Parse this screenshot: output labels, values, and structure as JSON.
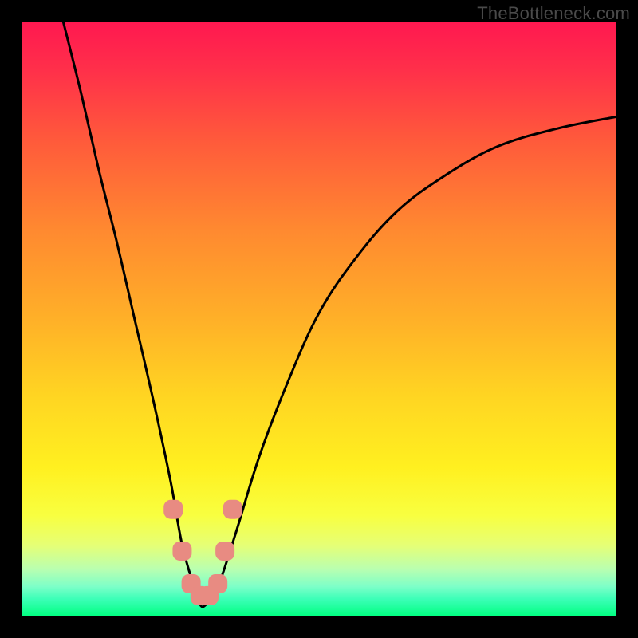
{
  "attribution": "TheBottleneck.com",
  "chart_data": {
    "type": "line",
    "title": "",
    "xlabel": "",
    "ylabel": "",
    "xlim": [
      0,
      100
    ],
    "ylim": [
      0,
      100
    ],
    "series": [
      {
        "name": "bottleneck-curve",
        "x": [
          7,
          10,
          13,
          16,
          19,
          22,
          25,
          27,
          29,
          30,
          31,
          33,
          36,
          40,
          45,
          50,
          56,
          63,
          71,
          80,
          90,
          100
        ],
        "y": [
          100,
          88,
          75,
          63,
          50,
          37,
          23,
          12,
          5,
          2,
          2,
          5,
          14,
          27,
          40,
          51,
          60,
          68,
          74,
          79,
          82,
          84
        ]
      }
    ],
    "markers": {
      "name": "highlight-dots",
      "color": "#e88b82",
      "points_xy": [
        [
          25.5,
          18
        ],
        [
          27,
          11
        ],
        [
          28.5,
          5.5
        ],
        [
          30,
          3.5
        ],
        [
          31.5,
          3.5
        ],
        [
          33,
          5.5
        ],
        [
          34.2,
          11
        ],
        [
          35.5,
          18
        ]
      ]
    }
  }
}
